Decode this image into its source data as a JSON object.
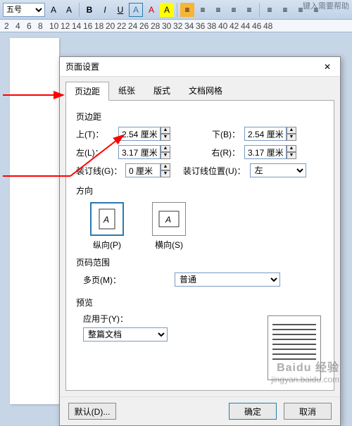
{
  "toolbar": {
    "tip": "键入需要帮助",
    "font_size": "五号",
    "buttons": [
      "B",
      "I",
      "U",
      "A",
      "A",
      "A",
      "≡",
      "≡",
      "≡",
      "≡",
      "≡",
      "≡",
      "≡",
      "≡"
    ]
  },
  "ruler": {
    "marks": [
      "2",
      "4",
      "6",
      "8",
      "10",
      "12",
      "14",
      "16",
      "18",
      "20",
      "22",
      "24",
      "26",
      "28",
      "30",
      "32",
      "34",
      "36",
      "38",
      "40",
      "42",
      "44",
      "46",
      "48"
    ]
  },
  "dialog": {
    "title": "页面设置",
    "close": "✕",
    "tabs": {
      "margins": "页边距",
      "paper": "纸张",
      "layout": "版式",
      "grid": "文档网格"
    },
    "margins_group": "页边距",
    "labels": {
      "top": "上(T)：",
      "bottom": "下(B)：",
      "left": "左(L)：",
      "right": "右(R)：",
      "gutter": "装订线(G)：",
      "gutter_pos": "装订线位置(U)："
    },
    "values": {
      "top": "2.54 厘米",
      "bottom": "2.54 厘米",
      "left": "3.17 厘米",
      "right": "3.17 厘米",
      "gutter": "0 厘米",
      "gutter_pos": "左"
    },
    "orientation": {
      "group": "方向",
      "portrait": "纵向(P)",
      "landscape": "横向(S)"
    },
    "pages": {
      "group": "页码范围",
      "multi_label": "多页(M)：",
      "multi_value": "普通"
    },
    "preview": {
      "group": "预览",
      "apply_label": "应用于(Y)：",
      "apply_value": "整篇文档"
    },
    "buttons": {
      "default": "默认(D)...",
      "ok": "确定",
      "cancel": "取消"
    }
  },
  "watermark": {
    "logo": "Baidu 经验",
    "url": "jingyan.baidu.com"
  }
}
